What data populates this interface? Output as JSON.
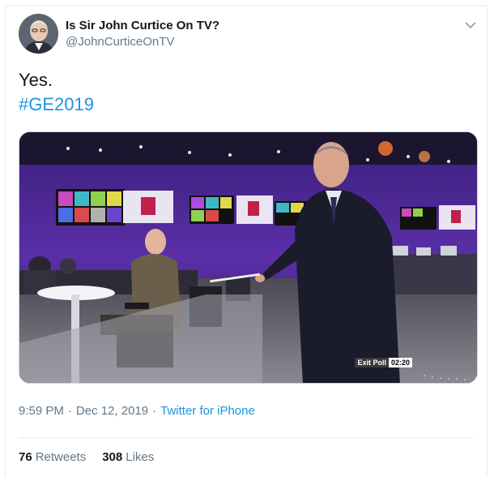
{
  "tweet": {
    "author": {
      "name": "Is Sir John Curtice On TV?",
      "handle": "@JohnCurticeOnTV"
    },
    "text": "Yes.",
    "hashtag": "#GE2019",
    "media": {
      "badge_label": "Exit Poll",
      "badge_time": "02:20"
    },
    "meta": {
      "time": "9:59 PM",
      "date": "Dec 12, 2019",
      "separator": "·",
      "source": "Twitter for iPhone"
    },
    "stats": {
      "retweets_count": "76",
      "retweets_label": "Retweets",
      "likes_count": "308",
      "likes_label": "Likes"
    }
  }
}
